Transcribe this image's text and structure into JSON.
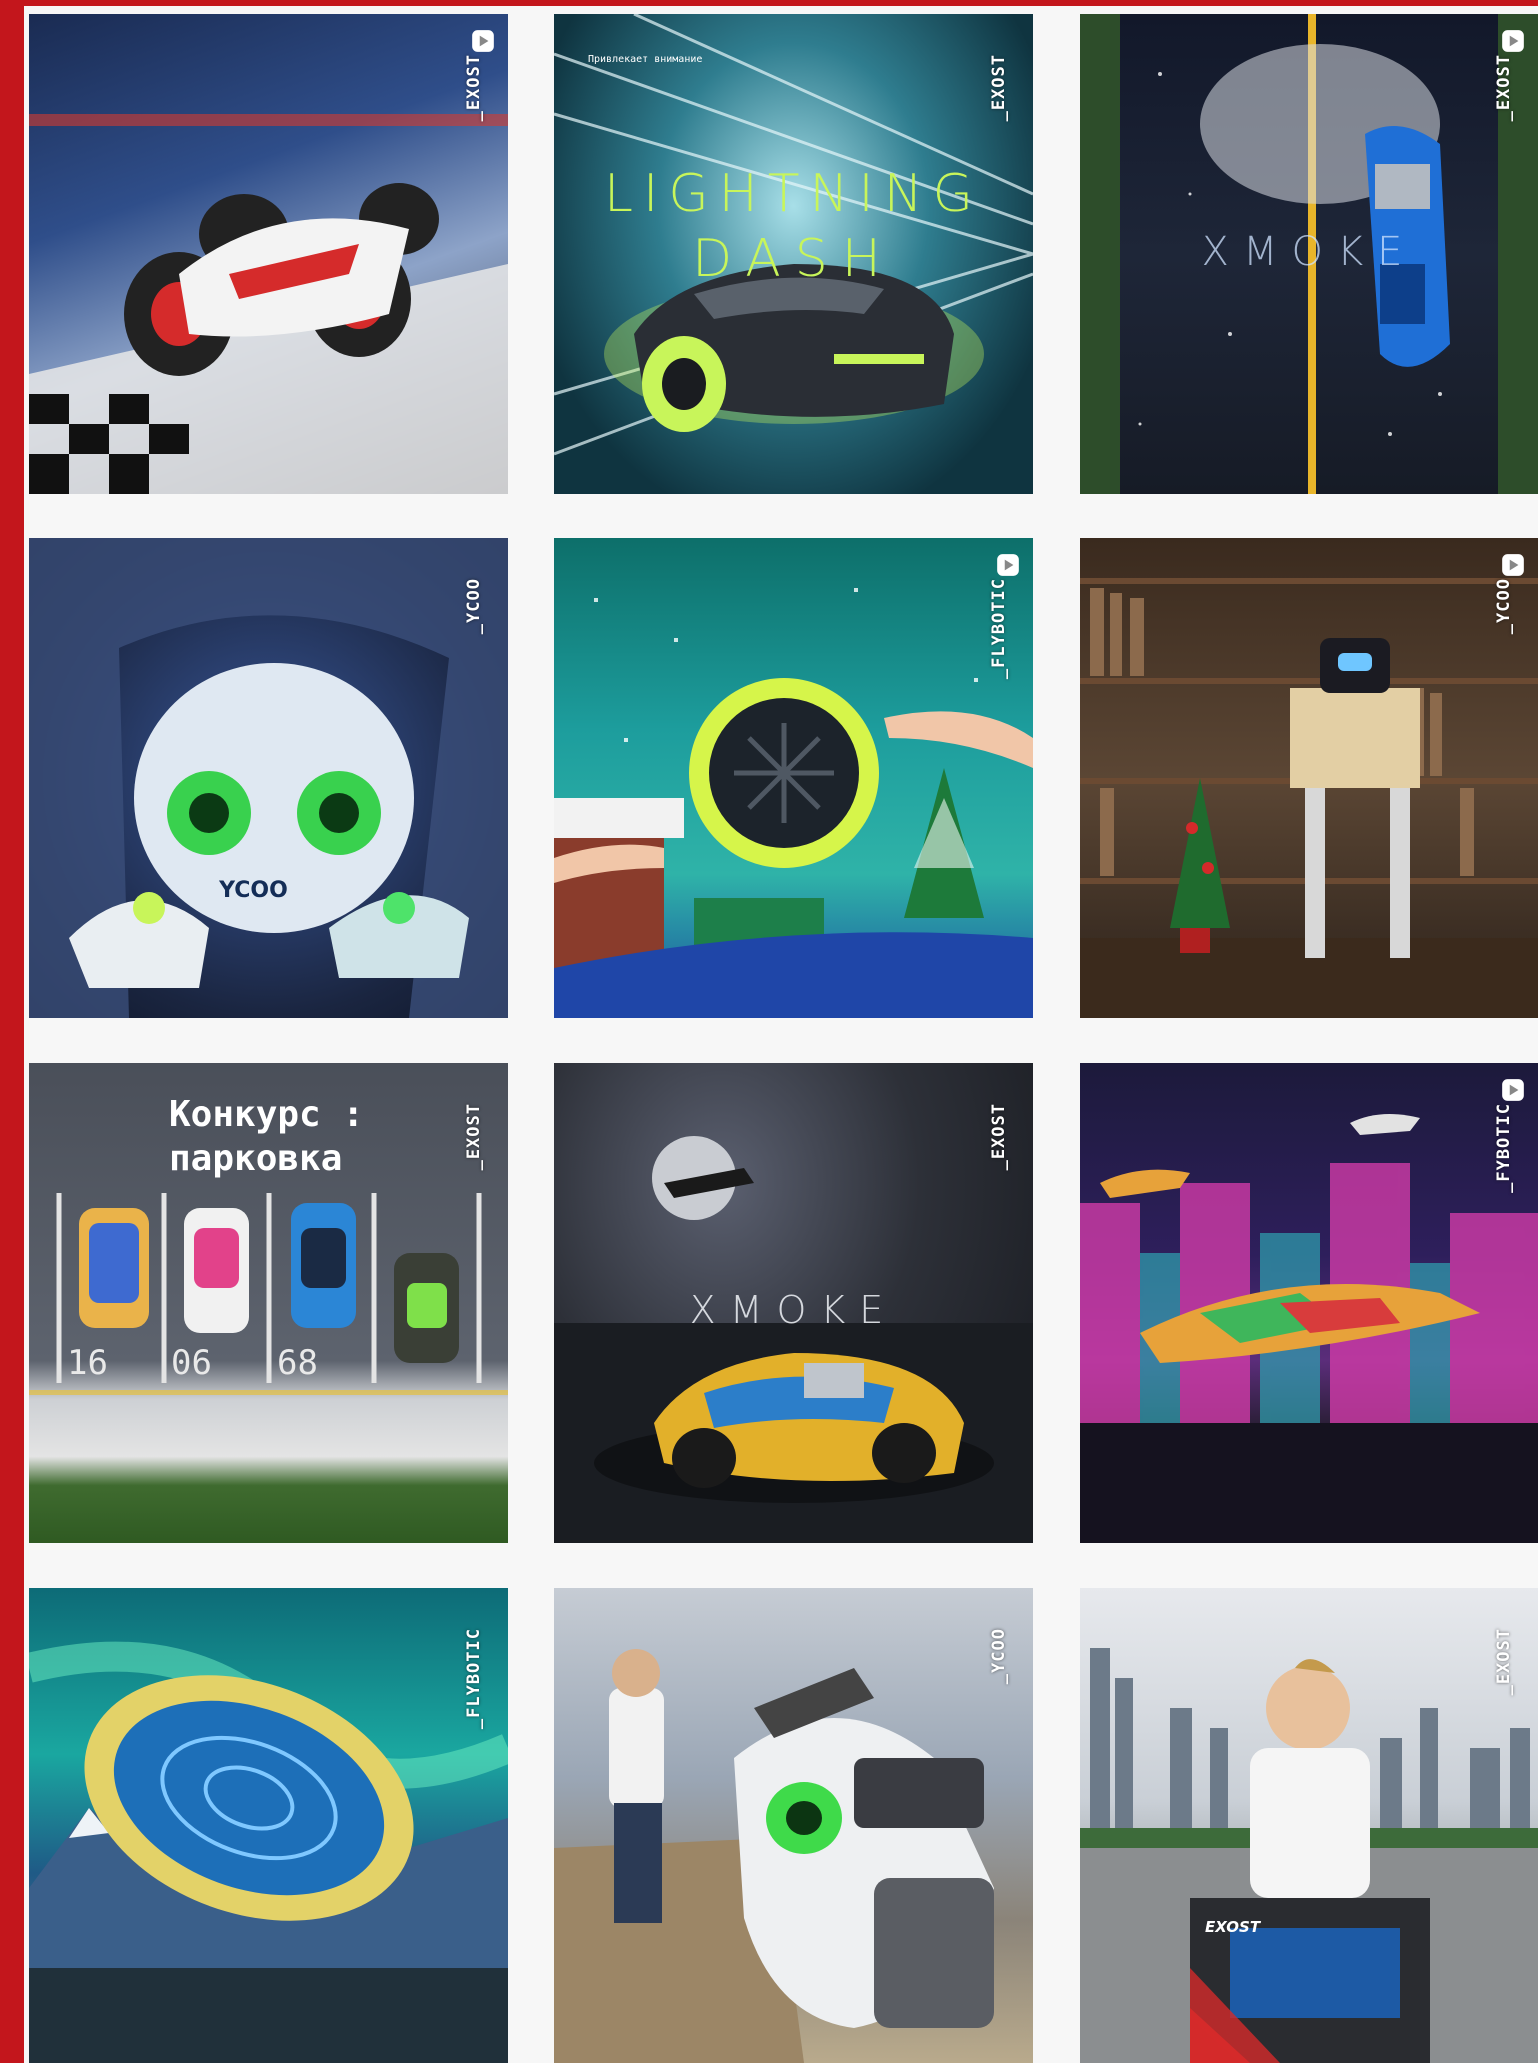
{
  "posts": [
    {
      "tag": "_EXOST",
      "has_reel": true
    },
    {
      "tag": "_EXOST",
      "has_reel": false,
      "kicker": "Привлекает внимание",
      "title_line1": "LIGHTNING",
      "title_line2": "DASH"
    },
    {
      "tag": "_EXOST",
      "has_reel": true,
      "title_line1": "XMOKE"
    },
    {
      "tag": "_YCOO",
      "has_reel": false,
      "logo": "YCOO"
    },
    {
      "tag": "_FLYBOTIC",
      "has_reel": true
    },
    {
      "tag": "_YCOO",
      "has_reel": true
    },
    {
      "tag": "_EXOST",
      "has_reel": false,
      "title_line1": "Конкурс :",
      "title_line2": "парковка",
      "spots": [
        "16",
        "06",
        "68"
      ]
    },
    {
      "tag": "_EXOST",
      "has_reel": false,
      "title_line1": "XMOKE"
    },
    {
      "tag": "_FYBOTIC",
      "has_reel": true
    },
    {
      "tag": "_FLYBOTIC",
      "has_reel": false
    },
    {
      "tag": "_YCOO",
      "has_reel": false
    },
    {
      "tag": "_EXOST",
      "has_reel": false,
      "box_brand": "EXOST"
    }
  ],
  "colors": {
    "brand_red": "#c3161c",
    "neon_green": "#c8f55a"
  }
}
